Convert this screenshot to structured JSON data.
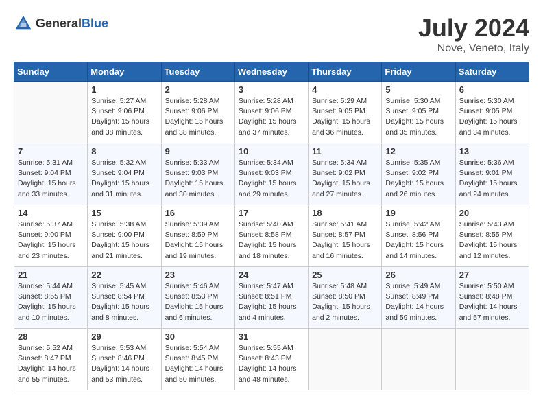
{
  "header": {
    "logo_general": "General",
    "logo_blue": "Blue",
    "month": "July 2024",
    "location": "Nove, Veneto, Italy"
  },
  "columns": [
    "Sunday",
    "Monday",
    "Tuesday",
    "Wednesday",
    "Thursday",
    "Friday",
    "Saturday"
  ],
  "weeks": [
    [
      {
        "day": "",
        "sunrise": "",
        "sunset": "",
        "daylight": ""
      },
      {
        "day": "1",
        "sunrise": "Sunrise: 5:27 AM",
        "sunset": "Sunset: 9:06 PM",
        "daylight": "Daylight: 15 hours and 38 minutes."
      },
      {
        "day": "2",
        "sunrise": "Sunrise: 5:28 AM",
        "sunset": "Sunset: 9:06 PM",
        "daylight": "Daylight: 15 hours and 38 minutes."
      },
      {
        "day": "3",
        "sunrise": "Sunrise: 5:28 AM",
        "sunset": "Sunset: 9:06 PM",
        "daylight": "Daylight: 15 hours and 37 minutes."
      },
      {
        "day": "4",
        "sunrise": "Sunrise: 5:29 AM",
        "sunset": "Sunset: 9:05 PM",
        "daylight": "Daylight: 15 hours and 36 minutes."
      },
      {
        "day": "5",
        "sunrise": "Sunrise: 5:30 AM",
        "sunset": "Sunset: 9:05 PM",
        "daylight": "Daylight: 15 hours and 35 minutes."
      },
      {
        "day": "6",
        "sunrise": "Sunrise: 5:30 AM",
        "sunset": "Sunset: 9:05 PM",
        "daylight": "Daylight: 15 hours and 34 minutes."
      }
    ],
    [
      {
        "day": "7",
        "sunrise": "Sunrise: 5:31 AM",
        "sunset": "Sunset: 9:04 PM",
        "daylight": "Daylight: 15 hours and 33 minutes."
      },
      {
        "day": "8",
        "sunrise": "Sunrise: 5:32 AM",
        "sunset": "Sunset: 9:04 PM",
        "daylight": "Daylight: 15 hours and 31 minutes."
      },
      {
        "day": "9",
        "sunrise": "Sunrise: 5:33 AM",
        "sunset": "Sunset: 9:03 PM",
        "daylight": "Daylight: 15 hours and 30 minutes."
      },
      {
        "day": "10",
        "sunrise": "Sunrise: 5:34 AM",
        "sunset": "Sunset: 9:03 PM",
        "daylight": "Daylight: 15 hours and 29 minutes."
      },
      {
        "day": "11",
        "sunrise": "Sunrise: 5:34 AM",
        "sunset": "Sunset: 9:02 PM",
        "daylight": "Daylight: 15 hours and 27 minutes."
      },
      {
        "day": "12",
        "sunrise": "Sunrise: 5:35 AM",
        "sunset": "Sunset: 9:02 PM",
        "daylight": "Daylight: 15 hours and 26 minutes."
      },
      {
        "day": "13",
        "sunrise": "Sunrise: 5:36 AM",
        "sunset": "Sunset: 9:01 PM",
        "daylight": "Daylight: 15 hours and 24 minutes."
      }
    ],
    [
      {
        "day": "14",
        "sunrise": "Sunrise: 5:37 AM",
        "sunset": "Sunset: 9:00 PM",
        "daylight": "Daylight: 15 hours and 23 minutes."
      },
      {
        "day": "15",
        "sunrise": "Sunrise: 5:38 AM",
        "sunset": "Sunset: 9:00 PM",
        "daylight": "Daylight: 15 hours and 21 minutes."
      },
      {
        "day": "16",
        "sunrise": "Sunrise: 5:39 AM",
        "sunset": "Sunset: 8:59 PM",
        "daylight": "Daylight: 15 hours and 19 minutes."
      },
      {
        "day": "17",
        "sunrise": "Sunrise: 5:40 AM",
        "sunset": "Sunset: 8:58 PM",
        "daylight": "Daylight: 15 hours and 18 minutes."
      },
      {
        "day": "18",
        "sunrise": "Sunrise: 5:41 AM",
        "sunset": "Sunset: 8:57 PM",
        "daylight": "Daylight: 15 hours and 16 minutes."
      },
      {
        "day": "19",
        "sunrise": "Sunrise: 5:42 AM",
        "sunset": "Sunset: 8:56 PM",
        "daylight": "Daylight: 15 hours and 14 minutes."
      },
      {
        "day": "20",
        "sunrise": "Sunrise: 5:43 AM",
        "sunset": "Sunset: 8:55 PM",
        "daylight": "Daylight: 15 hours and 12 minutes."
      }
    ],
    [
      {
        "day": "21",
        "sunrise": "Sunrise: 5:44 AM",
        "sunset": "Sunset: 8:55 PM",
        "daylight": "Daylight: 15 hours and 10 minutes."
      },
      {
        "day": "22",
        "sunrise": "Sunrise: 5:45 AM",
        "sunset": "Sunset: 8:54 PM",
        "daylight": "Daylight: 15 hours and 8 minutes."
      },
      {
        "day": "23",
        "sunrise": "Sunrise: 5:46 AM",
        "sunset": "Sunset: 8:53 PM",
        "daylight": "Daylight: 15 hours and 6 minutes."
      },
      {
        "day": "24",
        "sunrise": "Sunrise: 5:47 AM",
        "sunset": "Sunset: 8:51 PM",
        "daylight": "Daylight: 15 hours and 4 minutes."
      },
      {
        "day": "25",
        "sunrise": "Sunrise: 5:48 AM",
        "sunset": "Sunset: 8:50 PM",
        "daylight": "Daylight: 15 hours and 2 minutes."
      },
      {
        "day": "26",
        "sunrise": "Sunrise: 5:49 AM",
        "sunset": "Sunset: 8:49 PM",
        "daylight": "Daylight: 14 hours and 59 minutes."
      },
      {
        "day": "27",
        "sunrise": "Sunrise: 5:50 AM",
        "sunset": "Sunset: 8:48 PM",
        "daylight": "Daylight: 14 hours and 57 minutes."
      }
    ],
    [
      {
        "day": "28",
        "sunrise": "Sunrise: 5:52 AM",
        "sunset": "Sunset: 8:47 PM",
        "daylight": "Daylight: 14 hours and 55 minutes."
      },
      {
        "day": "29",
        "sunrise": "Sunrise: 5:53 AM",
        "sunset": "Sunset: 8:46 PM",
        "daylight": "Daylight: 14 hours and 53 minutes."
      },
      {
        "day": "30",
        "sunrise": "Sunrise: 5:54 AM",
        "sunset": "Sunset: 8:45 PM",
        "daylight": "Daylight: 14 hours and 50 minutes."
      },
      {
        "day": "31",
        "sunrise": "Sunrise: 5:55 AM",
        "sunset": "Sunset: 8:43 PM",
        "daylight": "Daylight: 14 hours and 48 minutes."
      },
      {
        "day": "",
        "sunrise": "",
        "sunset": "",
        "daylight": ""
      },
      {
        "day": "",
        "sunrise": "",
        "sunset": "",
        "daylight": ""
      },
      {
        "day": "",
        "sunrise": "",
        "sunset": "",
        "daylight": ""
      }
    ]
  ]
}
